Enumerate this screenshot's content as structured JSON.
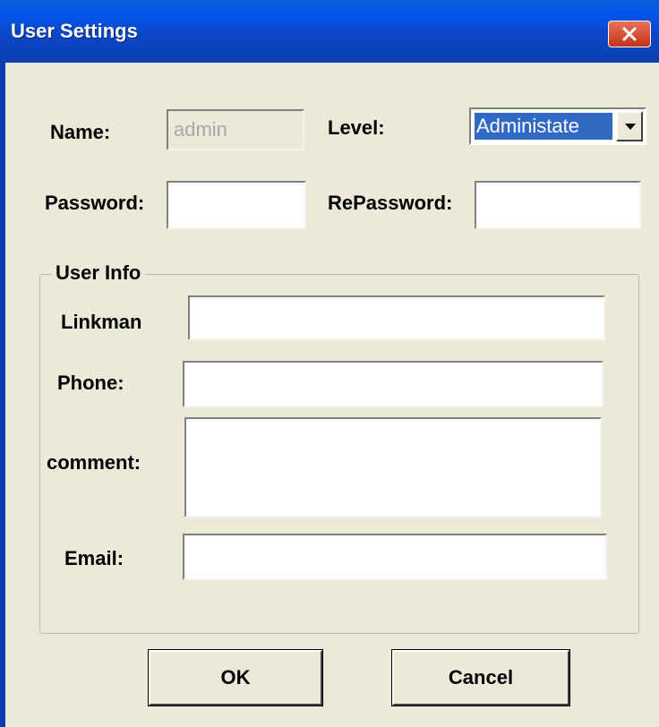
{
  "window": {
    "title": "User Settings"
  },
  "form": {
    "name_label": "Name:",
    "name_value": "admin",
    "level_label": "Level:",
    "level_value": "Administate",
    "password_label": "Password:",
    "repassword_label": "RePassword:"
  },
  "user_info": {
    "group_label": "User Info",
    "linkman_label": "Linkman",
    "phone_label": "Phone:",
    "comment_label": "comment:",
    "email_label": "Email:"
  },
  "buttons": {
    "ok_label": "OK",
    "cancel_label": "Cancel"
  },
  "colors": {
    "titlebar": "#0a46c6",
    "window_bg": "#ece9d8",
    "selection": "#316ac5",
    "close_button": "#c5321a"
  },
  "icons": {
    "close": "close-icon",
    "dropdown": "chevron-down-icon"
  }
}
